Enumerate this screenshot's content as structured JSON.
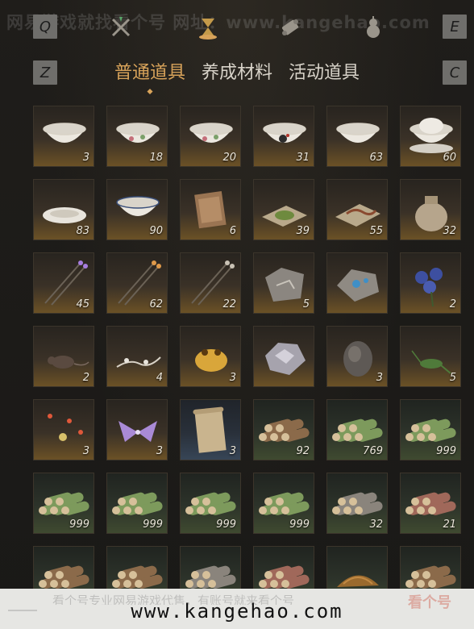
{
  "watermark_top": "网易游戏就找看个号  网址：www.kangehao.com",
  "keys": {
    "q": "Q",
    "e": "E",
    "z": "Z",
    "c": "C"
  },
  "top_icons": [
    {
      "name": "weapons-icon",
      "active": false
    },
    {
      "name": "crossed-tools-icon",
      "active": false
    },
    {
      "name": "hourglass-icon",
      "active": true
    },
    {
      "name": "scroll-icon",
      "active": false
    },
    {
      "name": "gourd-icon",
      "active": false
    }
  ],
  "tabs": [
    {
      "label": "普通道具",
      "active": true
    },
    {
      "label": "养成材料",
      "active": false
    },
    {
      "label": "活动道具",
      "active": false
    }
  ],
  "items": [
    {
      "icon": "white-bowl-icon",
      "count": "3",
      "bg": "gold"
    },
    {
      "icon": "floral-bowl-icon",
      "count": "18",
      "bg": "gold"
    },
    {
      "icon": "painted-bowl-icon",
      "count": "20",
      "bg": "gold"
    },
    {
      "icon": "rooster-bowl-icon",
      "count": "31",
      "bg": "gold"
    },
    {
      "icon": "porcelain-bowl-icon",
      "count": "63",
      "bg": "gold"
    },
    {
      "icon": "lidded-bowl-icon",
      "count": "60",
      "bg": "gold"
    },
    {
      "icon": "plate-icon",
      "count": "83",
      "bg": "gold"
    },
    {
      "icon": "blue-rim-bowl-icon",
      "count": "90",
      "bg": "gold"
    },
    {
      "icon": "wooden-box-icon",
      "count": "6",
      "bg": "gold"
    },
    {
      "icon": "herb-powder-icon",
      "count": "39",
      "bg": "gold"
    },
    {
      "icon": "worm-on-paper-icon",
      "count": "55",
      "bg": "gold"
    },
    {
      "icon": "cloth-sack-icon",
      "count": "32",
      "bg": "gold"
    },
    {
      "icon": "purple-arrows-icon",
      "count": "45",
      "bg": "gold"
    },
    {
      "icon": "orange-arrows-icon",
      "count": "62",
      "bg": "gold"
    },
    {
      "icon": "arrows-icon",
      "count": "22",
      "bg": "gold"
    },
    {
      "icon": "stone-tablet-icon",
      "count": "5",
      "bg": "gold"
    },
    {
      "icon": "blue-ore-icon",
      "count": "",
      "bg": "gold"
    },
    {
      "icon": "blue-flowers-icon",
      "count": "2",
      "bg": "gold"
    },
    {
      "icon": "rat-icon",
      "count": "2",
      "bg": "gold"
    },
    {
      "icon": "vine-branch-icon",
      "count": "4",
      "bg": "gold"
    },
    {
      "icon": "golden-toad-icon",
      "count": "3",
      "bg": "gold"
    },
    {
      "icon": "silver-ore-icon",
      "count": "",
      "bg": "gold"
    },
    {
      "icon": "dark-rock-icon",
      "count": "3",
      "bg": "gold"
    },
    {
      "icon": "cricket-icon",
      "count": "5",
      "bg": "gold"
    },
    {
      "icon": "fireflies-icon",
      "count": "3",
      "bg": "gold"
    },
    {
      "icon": "purple-butterfly-icon",
      "count": "3",
      "bg": "gold"
    },
    {
      "icon": "paper-scroll-icon",
      "count": "3",
      "bg": "blue"
    },
    {
      "icon": "log-bundle-icon",
      "count": "92",
      "bg": "green"
    },
    {
      "icon": "green-log-bundle-icon",
      "count": "769",
      "bg": "green"
    },
    {
      "icon": "green-log-bundle-icon",
      "count": "999",
      "bg": "green"
    },
    {
      "icon": "green-log-bundle-icon",
      "count": "999",
      "bg": "green"
    },
    {
      "icon": "green-log-bundle-icon",
      "count": "999",
      "bg": "green"
    },
    {
      "icon": "green-log-bundle-icon",
      "count": "999",
      "bg": "green"
    },
    {
      "icon": "green-log-bundle-icon",
      "count": "999",
      "bg": "green"
    },
    {
      "icon": "gray-log-bundle-icon",
      "count": "32",
      "bg": "green"
    },
    {
      "icon": "red-log-bundle-icon",
      "count": "21",
      "bg": "green"
    },
    {
      "icon": "log-bundle-icon",
      "count": "",
      "bg": "green"
    },
    {
      "icon": "log-bundle-icon",
      "count": "",
      "bg": "green"
    },
    {
      "icon": "gray-log-bundle-icon",
      "count": "",
      "bg": "green"
    },
    {
      "icon": "red-log-bundle-icon",
      "count": "",
      "bg": "green"
    },
    {
      "icon": "bark-pile-icon",
      "count": "",
      "bg": "green"
    },
    {
      "icon": "log-bundle-icon",
      "count": "",
      "bg": "green"
    }
  ],
  "footer": {
    "url": "www.kangehao.com",
    "watermark_line": "看个号专业网易游戏代售，有账号就来看个号",
    "logo": "看个号"
  },
  "colors": {
    "accent": "#d8a35a",
    "tab_text": "#d8d3c9",
    "background": "#1b1a18",
    "count_text": "#ebe6da"
  }
}
